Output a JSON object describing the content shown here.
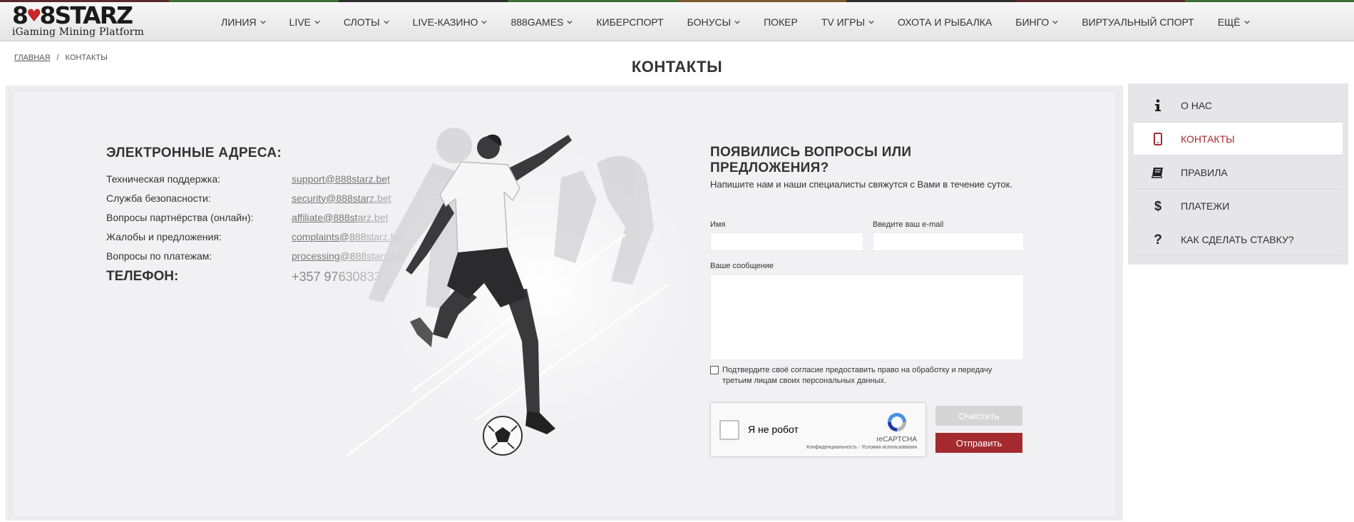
{
  "colors": {
    "accent": "#a52a2f",
    "clear_button": "#d5d5d5",
    "panel_bg": "#f1f1f3",
    "header_bg": "#e9e9e9"
  },
  "header": {
    "logo": {
      "main": "888STARZ",
      "sub": "iGaming Mining Platform"
    },
    "nav": [
      {
        "label": "ЛИНИЯ",
        "dropdown": true
      },
      {
        "label": "LIVE",
        "dropdown": true
      },
      {
        "label": "СЛОТЫ",
        "dropdown": true
      },
      {
        "label": "LIVE-КАЗИНО",
        "dropdown": true
      },
      {
        "label": "888GAMES",
        "dropdown": true
      },
      {
        "label": "КИБЕРСПОРТ",
        "dropdown": false
      },
      {
        "label": "БОНУСЫ",
        "dropdown": true
      },
      {
        "label": "ПОКЕР",
        "dropdown": false
      },
      {
        "label": "TV ИГРЫ",
        "dropdown": true
      },
      {
        "label": "ОХОТА И РЫБАЛКА",
        "dropdown": false
      },
      {
        "label": "БИНГО",
        "dropdown": true
      },
      {
        "label": "ВИРТУАЛЬНЫЙ СПОРТ",
        "dropdown": false
      },
      {
        "label": "ЕЩЁ",
        "dropdown": true
      }
    ]
  },
  "breadcrumb": {
    "home": "ГЛАВНАЯ",
    "separator": "/",
    "current": "КОНТАКТЫ"
  },
  "page_title": "КОНТАКТЫ",
  "contacts": {
    "emails_heading": "ЭЛЕКТРОННЫЕ АДРЕСА:",
    "emails": [
      {
        "label": "Техническая поддержка:",
        "email": "support@888starz.bet"
      },
      {
        "label": "Служба безопасности:",
        "email": "security@888starz.bet"
      },
      {
        "label": "Вопросы партнёрства (онлайн):",
        "email": "affiliate@888starz.bet"
      },
      {
        "label": "Жалобы и предложения:",
        "email": "complaints@888starz.bet"
      },
      {
        "label": "Вопросы по платежам:",
        "email": "processing@888starz.bet"
      }
    ],
    "phone_label": "ТЕЛЕФОН:",
    "phone": "+357 97630833"
  },
  "form": {
    "heading": "ПОЯВИЛИСЬ ВОПРОСЫ ИЛИ ПРЕДЛОЖЕНИЯ?",
    "subheading": "Напишите нам и наши специалисты свяжутся с Вами в течение суток.",
    "name_label": "Имя",
    "name_value": "",
    "email_label": "Введите ваш e-mail",
    "email_value": "",
    "message_label": "Ваше сообщение",
    "message_value": "",
    "consent": "Подтвердите своё согласие предоставить право на обработку и передачу третьим лицам своих персональных данных.",
    "consent_checked": false,
    "captcha": {
      "label": "Я не робот",
      "brand": "reCAPTCHA",
      "legal": "Конфиденциальность - Условия использования"
    },
    "clear_button": "Очистить",
    "send_button": "Отправить"
  },
  "sidebar": {
    "items": [
      {
        "label": "О НАС",
        "icon": "info-icon",
        "active": false
      },
      {
        "label": "КОНТАКТЫ",
        "icon": "phone-icon",
        "active": true
      },
      {
        "label": "ПРАВИЛА",
        "icon": "book-icon",
        "active": false
      },
      {
        "label": "ПЛАТЕЖИ",
        "icon": "dollar-icon",
        "active": false
      },
      {
        "label": "КАК СДЕЛАТЬ СТАВКУ?",
        "icon": "question-icon",
        "active": false
      }
    ]
  }
}
